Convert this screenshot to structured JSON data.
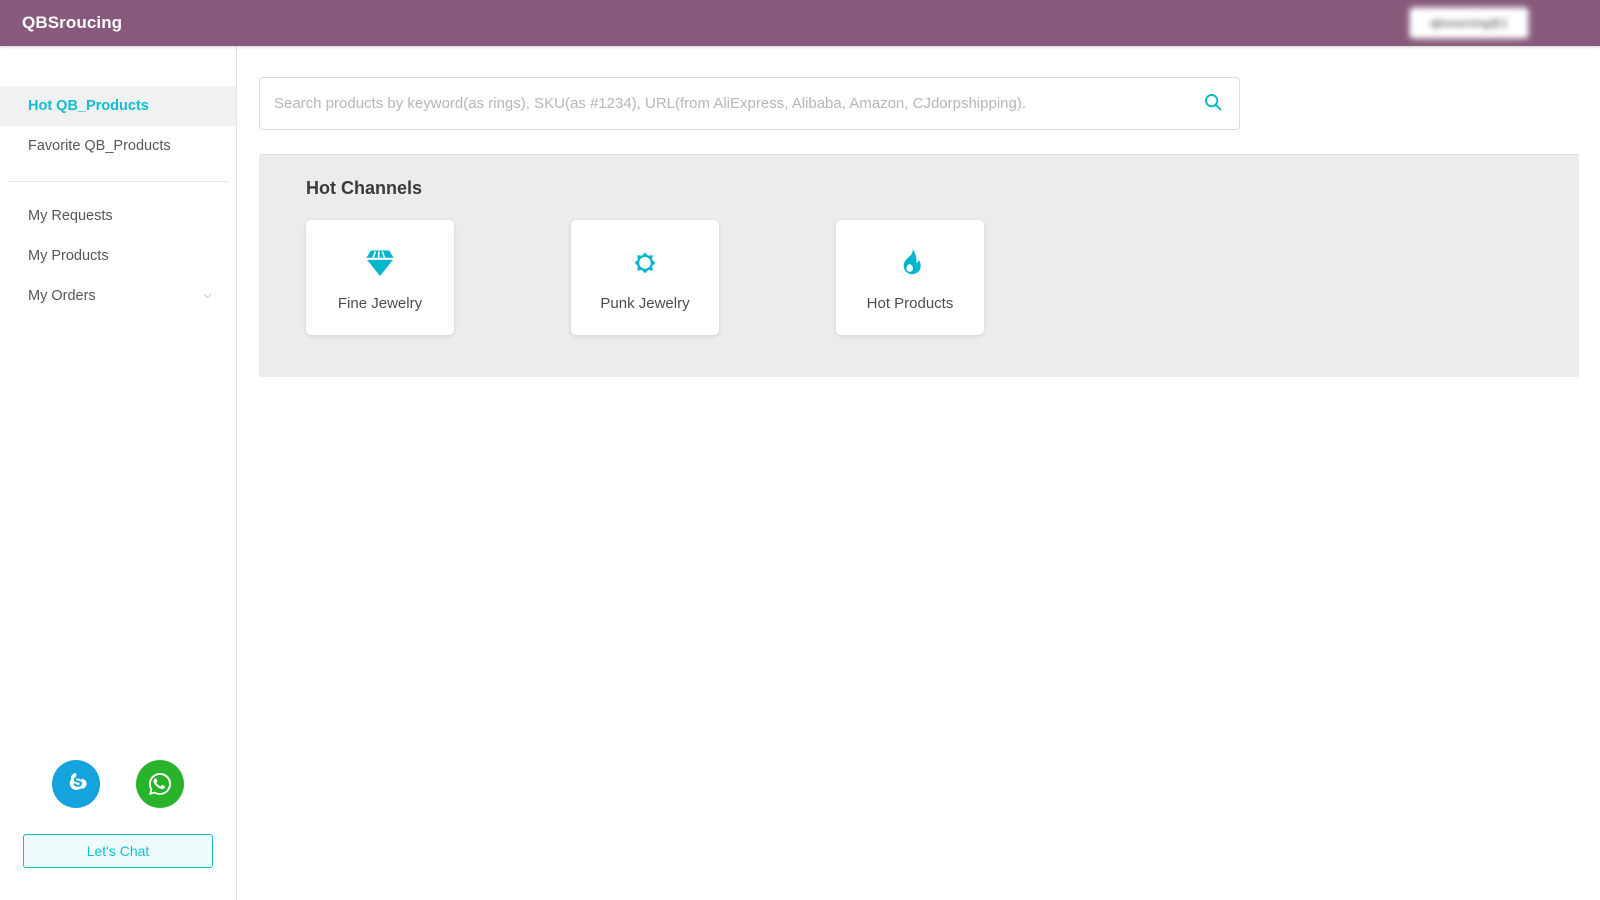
{
  "header": {
    "brand": "QBSroucing",
    "user_chip_label": "qbsourcing@1",
    "user_chip_blurred": true,
    "background_color": "#875a7b"
  },
  "theme": {
    "accent_color": "#11bed0",
    "brand_purple": "#875a7b",
    "panel_background": "#ececec",
    "text_color": "#53575b"
  },
  "sidebar": {
    "items": [
      {
        "label": "Hot QB_Products",
        "active": true,
        "has_chevron": false
      },
      {
        "label": "Favorite QB_Products",
        "active": false,
        "has_chevron": false
      },
      {
        "label": "My Requests",
        "active": false,
        "has_chevron": false
      },
      {
        "label": "My Products",
        "active": false,
        "has_chevron": false
      },
      {
        "label": "My Orders",
        "active": false,
        "has_chevron": true
      }
    ],
    "chat": {
      "skype_icon": "skype-icon",
      "whatsapp_icon": "whatsapp-icon",
      "button_label": "Let's Chat"
    }
  },
  "search": {
    "value": "",
    "placeholder": "Search products by keyword(as rings), SKU(as #1234), URL(from AliExpress, Alibaba, Amazon, CJdorpshipping).",
    "icon": "search-icon"
  },
  "main": {
    "panel_title": "Hot Channels",
    "channels": [
      {
        "label": "Fine Jewelry",
        "icon": "diamond-icon"
      },
      {
        "label": "Punk Jewelry",
        "icon": "sunburst-icon"
      },
      {
        "label": "Hot Products",
        "icon": "flame-icon"
      }
    ]
  }
}
